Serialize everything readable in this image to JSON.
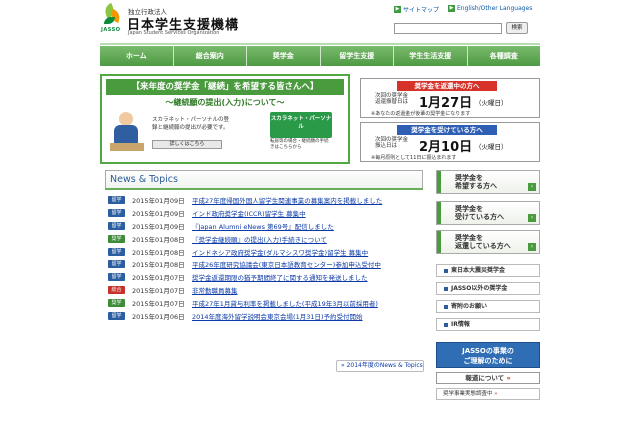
{
  "header": {
    "org_type": "独立行政法人",
    "org_name": "日本学生支援機構",
    "org_name_en": "Japan Student Services Organization",
    "logo_text": "JASSO",
    "sitemap_link": "サイトマップ",
    "english_link": "English/Other Languages",
    "search_button": "検索",
    "search_placeholder": ""
  },
  "nav": {
    "items": [
      "ホーム",
      "総合案内",
      "奨学金",
      "留学生支援",
      "学生生活支援",
      "各種調査"
    ]
  },
  "banner": {
    "title": "【来年度の奨学金「継続」を希望する皆さんへ】",
    "subtitle": "～継続願の提出(入力)について～",
    "text": "スカラネット・パーソナルの登録と継続願の提出が必要です。",
    "detail_button": "詳しくはこちら",
    "badge": "スカラネット・パーソナル",
    "badge_note": "転居等の場合・継続願の手続きはこちらから"
  },
  "notices": [
    {
      "head": "奨学金を返還中の方へ",
      "label": "次回の奨学金返還振替日は",
      "date": "1月27日",
      "day": "（火曜日）",
      "note": "※あなたの返還金が後輩の奨学金になります"
    },
    {
      "head": "奨学金を受けている方へ",
      "label": "次回の奨学金振込日は",
      "date": "2月10日",
      "day": "（火曜日）",
      "note": "※毎月原則として11日に振込まれます"
    }
  ],
  "news": {
    "title": "News & Topics",
    "items": [
      {
        "tag": "留学",
        "date": "2015年01月09日",
        "text": "平成27年度帰国外国人留学生関連事業の募集案内を掲載しました"
      },
      {
        "tag": "留学",
        "date": "2015年01月09日",
        "text": "インド政府奨学金(ICCR)留学生 募集中"
      },
      {
        "tag": "留学",
        "date": "2015年01月09日",
        "text": "『Japan Alumni eNews 第69号』配信しました"
      },
      {
        "tag": "奨学",
        "date": "2015年01月08日",
        "text": "『奨学金継続願』の提出(入力)手続きについて"
      },
      {
        "tag": "留学",
        "date": "2015年01月08日",
        "text": "インドネシア政府奨学金(ダルマシスワ奨学金)留学生 募集中"
      },
      {
        "tag": "留学",
        "date": "2015年01月08日",
        "text": "平成26年度研究協議会(東京日本語教育センター)参加申込受付中"
      },
      {
        "tag": "留学",
        "date": "2015年01月07日",
        "text": "奨学金返還期限の猶予期間終了に関する通知を発送しました"
      },
      {
        "tag": "総合",
        "date": "2015年01月07日",
        "text": "非常勤職員募集"
      },
      {
        "tag": "奨学",
        "date": "2015年01月07日",
        "text": "平成27年1月貸与利率を掲載しました(平成19年3月以前採用者)"
      },
      {
        "tag": "留学",
        "date": "2015年01月06日",
        "text": "2014年度海外留学説明会東京会場(1月31日)予約受付開始"
      }
    ],
    "more_link": "2014年度のNews & Topics"
  },
  "side": {
    "big_buttons": [
      {
        "line1": "奨学金を",
        "line2": "希望する方へ"
      },
      {
        "line1": "奨学金を",
        "line2": "受けている方へ"
      },
      {
        "line1": "奨学金を",
        "line2": "返還している方へ"
      }
    ],
    "small_buttons": [
      "東日本大震災奨学金",
      "JASSO以外の奨学金",
      "寄附のお願い",
      "IR情報"
    ],
    "box_line1": "JASSOの事業の",
    "box_line2": "ご理解のために",
    "report": "報道について",
    "survey": "奨学事業実態調査中"
  },
  "colors": {
    "nav_green": "#5aa44e",
    "notice_red": "#d6322a",
    "notice_blue": "#2f5fb4",
    "link_blue": "#0b3aa8"
  }
}
